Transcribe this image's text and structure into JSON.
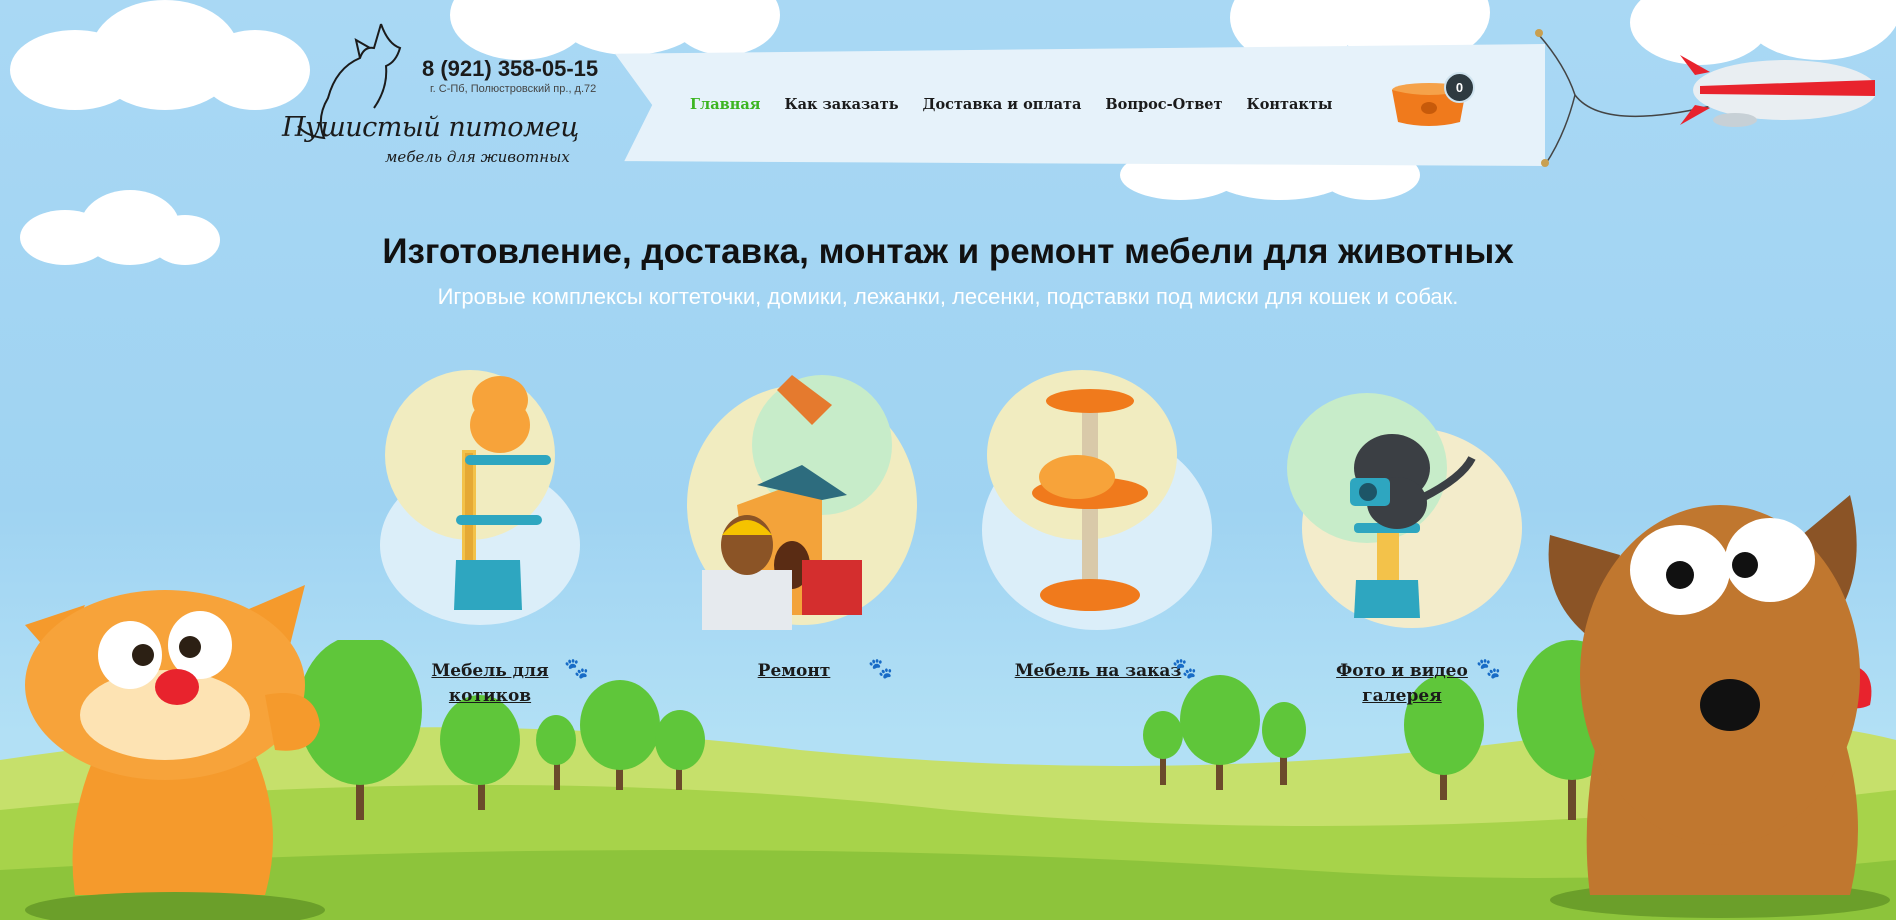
{
  "header": {
    "phone": "8 (921) 358-05-15",
    "address": "г. С-Пб, Полюстровский пр., д.72",
    "logo_title": "Пушистый питомец",
    "logo_subtitle": "мебель для животных"
  },
  "nav": {
    "items": [
      {
        "label": "Главная",
        "active": true
      },
      {
        "label": "Как заказать",
        "active": false
      },
      {
        "label": "Доставка и оплата",
        "active": false
      },
      {
        "label": "Вопрос-Ответ",
        "active": false
      },
      {
        "label": "Контакты",
        "active": false
      }
    ]
  },
  "cart": {
    "count": "0",
    "icon": "pet-bowl-cart-icon"
  },
  "hero": {
    "title": "Изготовление, доставка, монтаж и ремонт мебели для животных",
    "subtitle": "Игровые комплексы когтеточки, домики, лежанки, лесенки, подставки под миски для кошек и собак."
  },
  "categories": [
    {
      "label": "Мебель для котиков",
      "icon": "paw-icon"
    },
    {
      "label": "Ремонт",
      "icon": "paw-icon"
    },
    {
      "label": "Мебель на заказ",
      "icon": "paw-icon"
    },
    {
      "label": "Фото и видео галерея",
      "icon": "paw-icon"
    }
  ],
  "colors": {
    "sky": "#a9d8f4",
    "grass": "#a7d34a",
    "nav_active": "#3cb521",
    "cat_orange": "#f59a2c",
    "dog_brown": "#c0772f",
    "accent_orange": "#f07a1c",
    "accent_teal": "#2ea6c0"
  }
}
